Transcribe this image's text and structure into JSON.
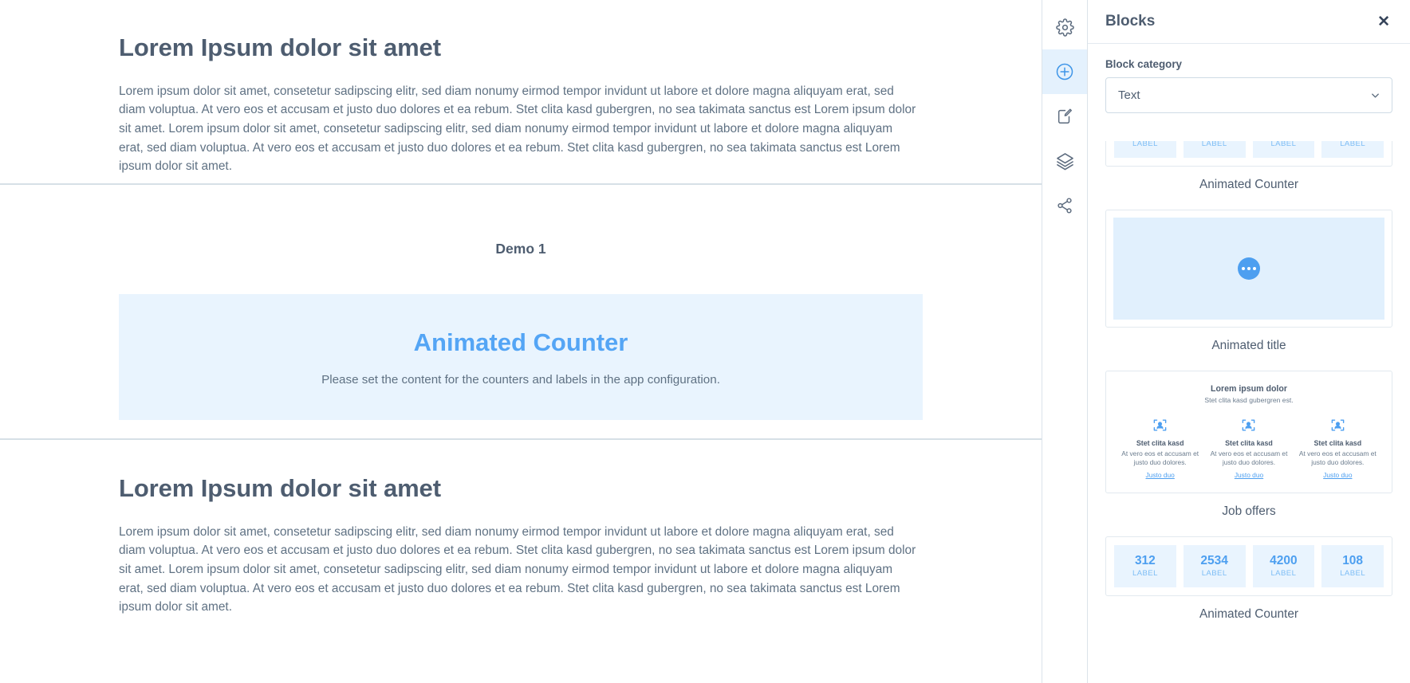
{
  "canvas": {
    "sections": [
      {
        "heading": "Lorem Ipsum dolor sit amet",
        "paragraph": "Lorem ipsum dolor sit amet, consetetur sadipscing elitr, sed diam nonumy eirmod tempor invidunt ut labore et dolore magna aliquyam erat, sed diam voluptua. At vero eos et accusam et justo duo dolores et ea rebum. Stet clita kasd gubergren, no sea takimata sanctus est Lorem ipsum dolor sit amet. Lorem ipsum dolor sit amet, consetetur sadipscing elitr, sed diam nonumy eirmod tempor invidunt ut labore et dolore magna aliquyam erat, sed diam voluptua. At vero eos et accusam et justo duo dolores et ea rebum. Stet clita kasd gubergren, no sea takimata sanctus est Lorem ipsum dolor sit amet."
      }
    ],
    "demo": {
      "title": "Demo 1",
      "placeholder_title": "Animated Counter",
      "placeholder_subtitle": "Please set the content for the counters and labels in the app configuration."
    },
    "section_bottom": {
      "heading": "Lorem Ipsum dolor sit amet",
      "paragraph": "Lorem ipsum dolor sit amet, consetetur sadipscing elitr, sed diam nonumy eirmod tempor invidunt ut labore et dolore magna aliquyam erat, sed diam voluptua. At vero eos et accusam et justo duo dolores et ea rebum. Stet clita kasd gubergren, no sea takimata sanctus est Lorem ipsum dolor sit amet. Lorem ipsum dolor sit amet, consetetur sadipscing elitr, sed diam nonumy eirmod tempor invidunt ut labore et dolore magna aliquyam erat, sed diam voluptua. At vero eos et accusam et justo duo dolores et ea rebum. Stet clita kasd gubergren, no sea takimata sanctus est Lorem ipsum dolor sit amet."
    }
  },
  "rail": {
    "items": [
      {
        "icon": "gear-icon",
        "name": "settings",
        "active": false
      },
      {
        "icon": "plus-circle-icon",
        "name": "add-block",
        "active": true
      },
      {
        "icon": "document-edit-icon",
        "name": "edit-content",
        "active": false
      },
      {
        "icon": "layers-icon",
        "name": "layers",
        "active": false
      },
      {
        "icon": "share-icon",
        "name": "share",
        "active": false
      }
    ]
  },
  "panel": {
    "title": "Blocks",
    "close_label": "✕",
    "category_label": "Block category",
    "category_value": "Text",
    "blocks": [
      {
        "name": "Animated Counter",
        "type": "counter",
        "counters": [
          {
            "value": "",
            "label": "LABEL"
          },
          {
            "value": "",
            "label": "LABEL"
          },
          {
            "value": "",
            "label": "LABEL"
          },
          {
            "value": "",
            "label": "LABEL"
          }
        ],
        "clipped": true
      },
      {
        "name": "Animated title",
        "type": "animated-title"
      },
      {
        "name": "Job offers",
        "type": "job-offers",
        "title": "Lorem ipsum dolor",
        "subtitle": "Stet clita kasd gubergren est.",
        "columns": [
          {
            "heading": "Stet clita kasd",
            "text": "At vero eos et accusam et justo duo dolores.",
            "link": "Justo duo"
          },
          {
            "heading": "Stet clita kasd",
            "text": "At vero eos et accusam et justo duo dolores.",
            "link": "Justo duo"
          },
          {
            "heading": "Stet clita kasd",
            "text": "At vero eos et accusam et justo duo dolores.",
            "link": "Justo duo"
          }
        ]
      },
      {
        "name": "Animated Counter",
        "type": "counter",
        "counters": [
          {
            "value": "312",
            "label": "LABEL"
          },
          {
            "value": "2534",
            "label": "LABEL"
          },
          {
            "value": "4200",
            "label": "LABEL"
          },
          {
            "value": "108",
            "label": "LABEL"
          }
        ],
        "clipped": false
      }
    ]
  },
  "colors": {
    "accent": "#4d9ff0",
    "accent_light": "#e9f4fe",
    "text_dark": "#4e5d70",
    "text_muted": "#5f7183",
    "rule": "#d6e0e6"
  }
}
